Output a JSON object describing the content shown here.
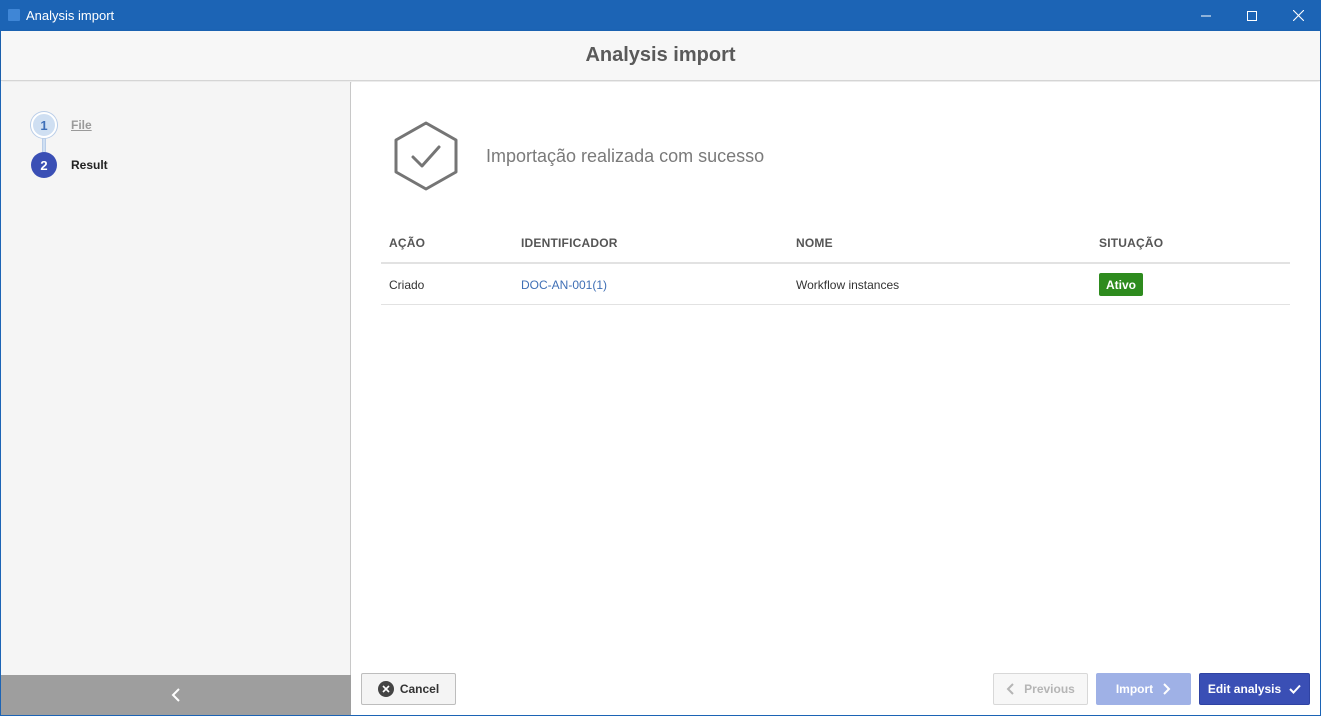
{
  "window": {
    "title": "Analysis import",
    "accent_color": "#1c64b5"
  },
  "header": {
    "title": "Analysis import"
  },
  "steps": [
    {
      "number": "1",
      "label": "File",
      "state": "completed"
    },
    {
      "number": "2",
      "label": "Result",
      "state": "active"
    }
  ],
  "result": {
    "message": "Importação realizada com sucesso",
    "icon": "check-hexagon-icon"
  },
  "table": {
    "columns": [
      "AÇÃO",
      "IDENTIFICADOR",
      "NOME",
      "SITUAÇÃO"
    ],
    "rows": [
      {
        "action": "Criado",
        "identifier": "DOC-AN-001(1)",
        "name": "Workflow instances",
        "status": "Ativo",
        "status_color": "#2e8b1e"
      }
    ]
  },
  "footer": {
    "cancel_label": "Cancel",
    "previous_label": "Previous",
    "import_label": "Import",
    "edit_label": "Edit analysis",
    "primary_color": "#3a4fb5"
  }
}
